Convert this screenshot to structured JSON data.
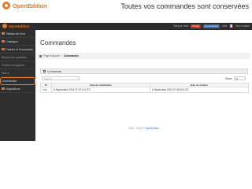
{
  "slide": {
    "brand": "OpenEdition",
    "title": "Toutes vos commandes sont conservées"
  },
  "topbar": {
    "logo": "OpenEdition",
    "user_text": "Bonjour Jean",
    "badge_red": "Panier",
    "badge_blue": "Commandes",
    "help": "Aide",
    "account": "Mon compte"
  },
  "sidebar": {
    "items": [
      {
        "label": "Tableau de bord",
        "icon": "dashboard-icon"
      },
      {
        "label": "Catalogue",
        "icon": "catalog-icon"
      },
      {
        "label": "Paniers et Commander",
        "icon": "cart-icon"
      },
      {
        "label": "Ressources gratuites",
        "icon": "free-resources-icon"
      },
      {
        "label": "Paniers enregistrés",
        "icon": "saved-carts-icon"
      },
      {
        "label": "Mes cl",
        "icon": "keys-icon"
      },
      {
        "label": "Commandes",
        "icon": "orders-icon"
      },
      {
        "label": "Acquisitions",
        "icon": "acquisitions-icon"
      }
    ]
  },
  "main": {
    "page_title": "Commandes",
    "breadcrumb": {
      "home": "Page d'accueil",
      "current": "Commandes"
    },
    "panel_title": "Commandes",
    "search_placeholder": "Search:",
    "show_label": "Show:",
    "show_value": "10",
    "table": {
      "headers": [
        "N°",
        "Date de modification",
        "Date de création"
      ],
      "rows": [
        {
          "id": "Voir",
          "modified": "6 Septembre 2013 07:47:14 UTC",
          "created": "6 Septembre 2013 07:46:50 UTC"
        }
      ]
    },
    "footer": {
      "text": "2012 - 2013 ©",
      "link": "OpenEdition"
    }
  },
  "colors": {
    "accent": "#e7792b",
    "sidebar_bg": "#2f2f2f",
    "topbar_bg": "#2c2c2c",
    "link": "#2a6db5"
  }
}
